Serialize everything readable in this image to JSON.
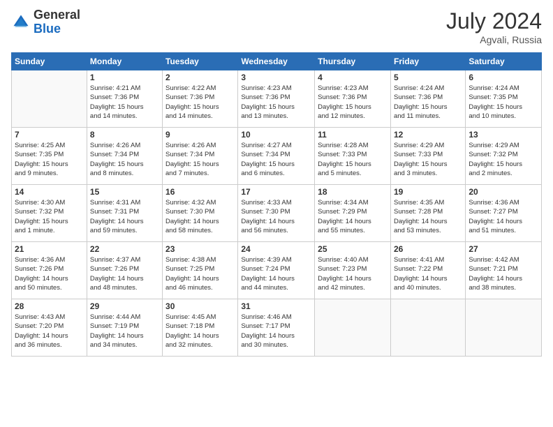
{
  "header": {
    "logo_general": "General",
    "logo_blue": "Blue",
    "month_year": "July 2024",
    "location": "Agvali, Russia"
  },
  "days_of_week": [
    "Sunday",
    "Monday",
    "Tuesday",
    "Wednesday",
    "Thursday",
    "Friday",
    "Saturday"
  ],
  "weeks": [
    [
      {
        "day": "",
        "content": ""
      },
      {
        "day": "1",
        "content": "Sunrise: 4:21 AM\nSunset: 7:36 PM\nDaylight: 15 hours\nand 14 minutes."
      },
      {
        "day": "2",
        "content": "Sunrise: 4:22 AM\nSunset: 7:36 PM\nDaylight: 15 hours\nand 14 minutes."
      },
      {
        "day": "3",
        "content": "Sunrise: 4:23 AM\nSunset: 7:36 PM\nDaylight: 15 hours\nand 13 minutes."
      },
      {
        "day": "4",
        "content": "Sunrise: 4:23 AM\nSunset: 7:36 PM\nDaylight: 15 hours\nand 12 minutes."
      },
      {
        "day": "5",
        "content": "Sunrise: 4:24 AM\nSunset: 7:36 PM\nDaylight: 15 hours\nand 11 minutes."
      },
      {
        "day": "6",
        "content": "Sunrise: 4:24 AM\nSunset: 7:35 PM\nDaylight: 15 hours\nand 10 minutes."
      }
    ],
    [
      {
        "day": "7",
        "content": "Sunrise: 4:25 AM\nSunset: 7:35 PM\nDaylight: 15 hours\nand 9 minutes."
      },
      {
        "day": "8",
        "content": "Sunrise: 4:26 AM\nSunset: 7:34 PM\nDaylight: 15 hours\nand 8 minutes."
      },
      {
        "day": "9",
        "content": "Sunrise: 4:26 AM\nSunset: 7:34 PM\nDaylight: 15 hours\nand 7 minutes."
      },
      {
        "day": "10",
        "content": "Sunrise: 4:27 AM\nSunset: 7:34 PM\nDaylight: 15 hours\nand 6 minutes."
      },
      {
        "day": "11",
        "content": "Sunrise: 4:28 AM\nSunset: 7:33 PM\nDaylight: 15 hours\nand 5 minutes."
      },
      {
        "day": "12",
        "content": "Sunrise: 4:29 AM\nSunset: 7:33 PM\nDaylight: 15 hours\nand 3 minutes."
      },
      {
        "day": "13",
        "content": "Sunrise: 4:29 AM\nSunset: 7:32 PM\nDaylight: 15 hours\nand 2 minutes."
      }
    ],
    [
      {
        "day": "14",
        "content": "Sunrise: 4:30 AM\nSunset: 7:32 PM\nDaylight: 15 hours\nand 1 minute."
      },
      {
        "day": "15",
        "content": "Sunrise: 4:31 AM\nSunset: 7:31 PM\nDaylight: 14 hours\nand 59 minutes."
      },
      {
        "day": "16",
        "content": "Sunrise: 4:32 AM\nSunset: 7:30 PM\nDaylight: 14 hours\nand 58 minutes."
      },
      {
        "day": "17",
        "content": "Sunrise: 4:33 AM\nSunset: 7:30 PM\nDaylight: 14 hours\nand 56 minutes."
      },
      {
        "day": "18",
        "content": "Sunrise: 4:34 AM\nSunset: 7:29 PM\nDaylight: 14 hours\nand 55 minutes."
      },
      {
        "day": "19",
        "content": "Sunrise: 4:35 AM\nSunset: 7:28 PM\nDaylight: 14 hours\nand 53 minutes."
      },
      {
        "day": "20",
        "content": "Sunrise: 4:36 AM\nSunset: 7:27 PM\nDaylight: 14 hours\nand 51 minutes."
      }
    ],
    [
      {
        "day": "21",
        "content": "Sunrise: 4:36 AM\nSunset: 7:26 PM\nDaylight: 14 hours\nand 50 minutes."
      },
      {
        "day": "22",
        "content": "Sunrise: 4:37 AM\nSunset: 7:26 PM\nDaylight: 14 hours\nand 48 minutes."
      },
      {
        "day": "23",
        "content": "Sunrise: 4:38 AM\nSunset: 7:25 PM\nDaylight: 14 hours\nand 46 minutes."
      },
      {
        "day": "24",
        "content": "Sunrise: 4:39 AM\nSunset: 7:24 PM\nDaylight: 14 hours\nand 44 minutes."
      },
      {
        "day": "25",
        "content": "Sunrise: 4:40 AM\nSunset: 7:23 PM\nDaylight: 14 hours\nand 42 minutes."
      },
      {
        "day": "26",
        "content": "Sunrise: 4:41 AM\nSunset: 7:22 PM\nDaylight: 14 hours\nand 40 minutes."
      },
      {
        "day": "27",
        "content": "Sunrise: 4:42 AM\nSunset: 7:21 PM\nDaylight: 14 hours\nand 38 minutes."
      }
    ],
    [
      {
        "day": "28",
        "content": "Sunrise: 4:43 AM\nSunset: 7:20 PM\nDaylight: 14 hours\nand 36 minutes."
      },
      {
        "day": "29",
        "content": "Sunrise: 4:44 AM\nSunset: 7:19 PM\nDaylight: 14 hours\nand 34 minutes."
      },
      {
        "day": "30",
        "content": "Sunrise: 4:45 AM\nSunset: 7:18 PM\nDaylight: 14 hours\nand 32 minutes."
      },
      {
        "day": "31",
        "content": "Sunrise: 4:46 AM\nSunset: 7:17 PM\nDaylight: 14 hours\nand 30 minutes."
      },
      {
        "day": "",
        "content": ""
      },
      {
        "day": "",
        "content": ""
      },
      {
        "day": "",
        "content": ""
      }
    ]
  ]
}
